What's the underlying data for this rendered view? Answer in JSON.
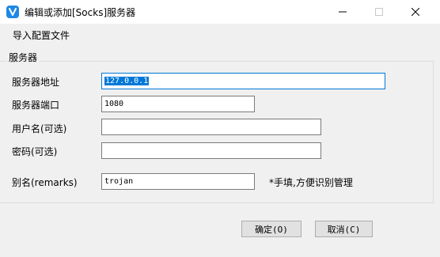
{
  "window": {
    "title": "编辑或添加[Socks]服务器",
    "accent_color": "#0078d7",
    "controls": [
      "minimize-icon",
      "maximize-icon",
      "close-icon"
    ]
  },
  "menu": {
    "import_label": "导入配置文件"
  },
  "group": {
    "title": "服务器"
  },
  "form": {
    "address_label": "服务器地址",
    "address_value": "127.0.0.1",
    "port_label": "服务器端口",
    "port_value": "1080",
    "username_label": "用户名(可选)",
    "username_value": "",
    "password_label": "密码(可选)",
    "password_value": "",
    "remarks_label": "别名(remarks)",
    "remarks_value": "trojan",
    "remarks_hint": "*手填,方便识别管理"
  },
  "buttons": {
    "ok_label": "确定(O)",
    "cancel_label": "取消(C)"
  }
}
